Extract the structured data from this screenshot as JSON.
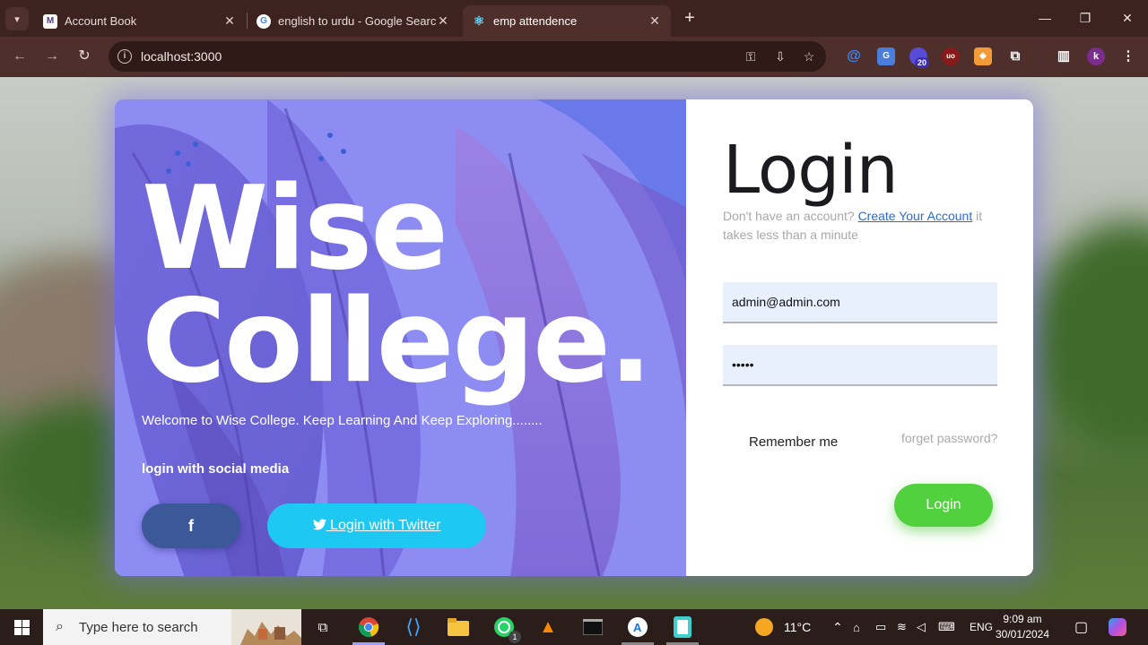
{
  "browser": {
    "tabs": [
      {
        "title": "Account Book",
        "icon": "account-book-favicon",
        "active": false
      },
      {
        "title": "english to urdu - Google Search",
        "icon": "google-favicon",
        "active": false
      },
      {
        "title": "emp attendence",
        "icon": "react-favicon",
        "active": true
      }
    ],
    "url": "localhost:3000",
    "profile_initial": "k",
    "extension_badge": "20"
  },
  "brand": {
    "line1": "Wise",
    "line2": "College.",
    "welcome": "Welcome to Wise College. Keep Learning And Keep Exploring........",
    "social_title": "login with social media",
    "facebook_label": "f",
    "twitter_label": " Login with Twitter",
    "background_color": "#8e8df2",
    "facebook_color": "#3b5998",
    "twitter_color": "#1dc8f2"
  },
  "login": {
    "title": "Login",
    "signup_prefix": "Don't have an account? ",
    "signup_link": "Create Your Account",
    "signup_suffix": " it takes less than a minute",
    "email_value": "admin@admin.com",
    "password_value": "•••••",
    "remember_label": "Remember me",
    "forget_label": "forget password?",
    "button_label": "Login",
    "button_color": "#52d13e"
  },
  "taskbar": {
    "search_placeholder": "Type here to search",
    "whatsapp_badge": "1",
    "weather_temp": "11°C",
    "language": "ENG",
    "time": "9:09 am",
    "date": "30/01/2024"
  }
}
